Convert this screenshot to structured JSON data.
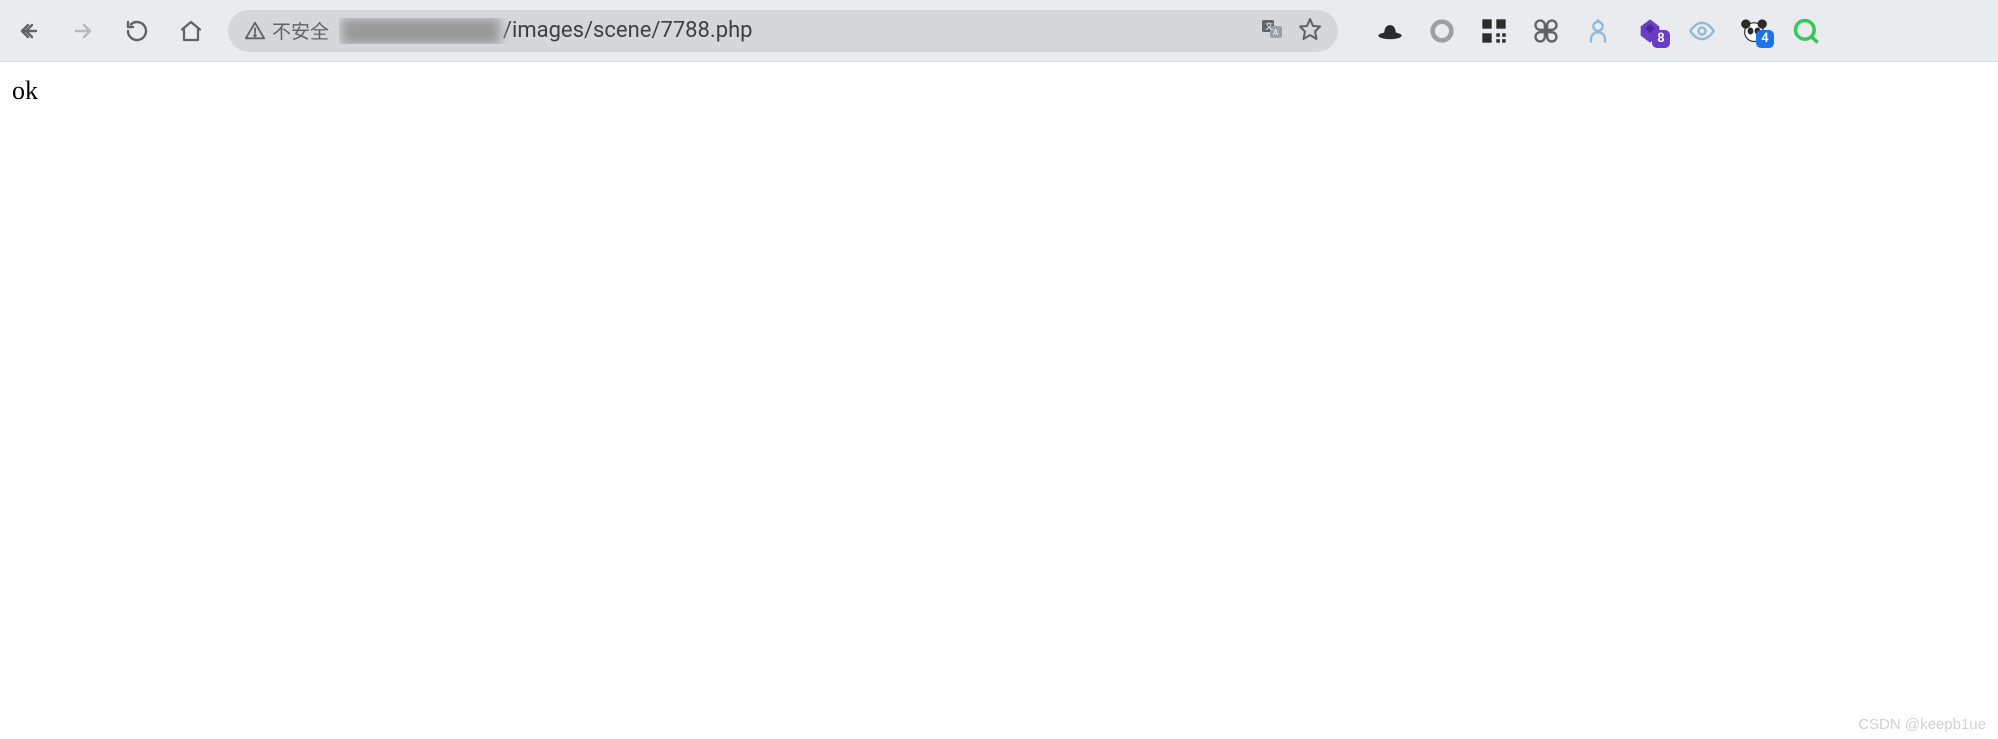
{
  "toolbar": {
    "security_label": "不安全",
    "url_hidden": "██████████",
    "url_visible": "/images/scene/7788.php"
  },
  "extensions": {
    "badge1": "8",
    "badge2": "4"
  },
  "page": {
    "body_text": "ok"
  },
  "watermark": "CSDN @keepb1ue"
}
